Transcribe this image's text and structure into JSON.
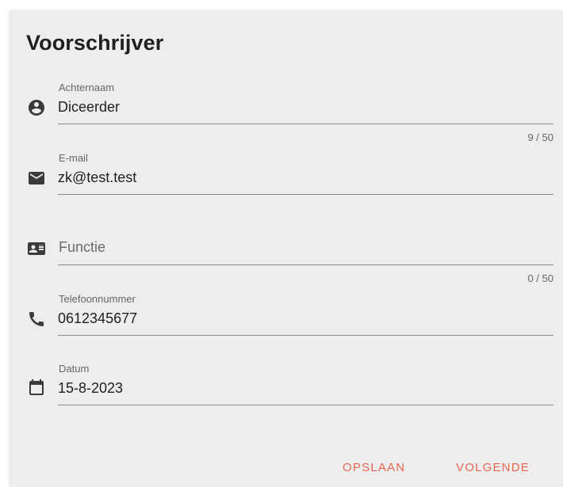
{
  "card": {
    "title": "Voorschrijver"
  },
  "fields": {
    "achternaam": {
      "label": "Achternaam",
      "value": "Diceerder",
      "counter": "9 / 50",
      "icon": "account-circle-icon"
    },
    "email": {
      "label": "E-mail",
      "value": "zk@test.test",
      "icon": "email-icon"
    },
    "functie": {
      "label": "Functie",
      "value": "",
      "counter": "0 / 50",
      "icon": "badge-icon"
    },
    "telefoonnummer": {
      "label": "Telefoonnummer",
      "value": "0612345677",
      "icon": "phone-icon"
    },
    "datum": {
      "label": "Datum",
      "value": "15-8-2023",
      "icon": "calendar-icon"
    }
  },
  "actions": {
    "save_label": "OPSLAAN",
    "next_label": "VOLGENDE"
  },
  "colors": {
    "accent": "#e8664f",
    "card_background": "#ededed",
    "text": "#1f1f1f",
    "icon": "#3a3a3a"
  }
}
